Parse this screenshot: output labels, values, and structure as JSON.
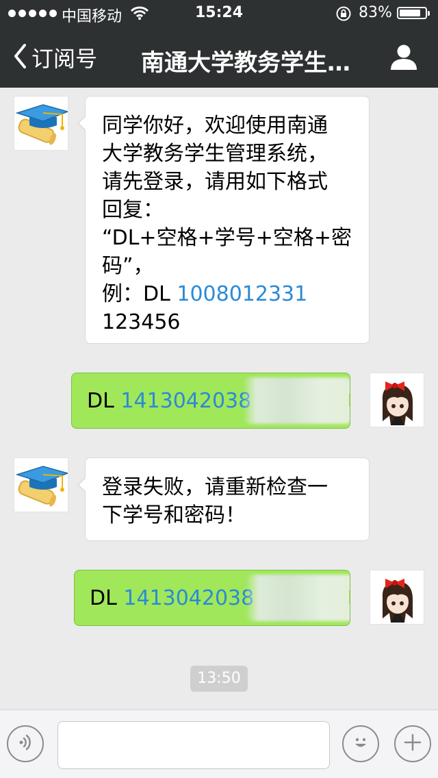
{
  "status_bar": {
    "carrier": "中国移动",
    "time": "15:24",
    "battery_percent": "83%",
    "battery_level": 0.83
  },
  "nav": {
    "back_label": "订阅号",
    "title": "南通大学教务学生…"
  },
  "messages": [
    {
      "side": "incoming",
      "lines": [
        "同学你好，欢迎使用南通",
        "大学教务学生管理系统，",
        "请先登录，请用如下格式",
        "回复：",
        "“DL+空格+学号+空格+密",
        "码”，"
      ],
      "example_prefix": "例：DL ",
      "example_link": "1008012331",
      "example_password": "123456"
    },
    {
      "side": "outgoing",
      "prefix": "DL ",
      "link": "1413042038"
    },
    {
      "side": "incoming",
      "lines": [
        "登录失败，请重新检查一",
        "下学号和密码！"
      ]
    },
    {
      "side": "outgoing",
      "prefix": "DL ",
      "link": "1413042038"
    }
  ],
  "timestamp": "13:50",
  "input": {
    "value": "",
    "placeholder": ""
  },
  "colors": {
    "nav_background": "#2e3132",
    "chat_background": "#ebebeb",
    "outgoing_bubble": "#a0e75a",
    "incoming_bubble": "#ffffff",
    "link": "#2a8ad6"
  },
  "icons": {
    "voice": "voice-icon",
    "emoji": "emoji-icon",
    "more": "plus-icon",
    "profile": "person-icon",
    "back": "chevron-left-icon"
  }
}
